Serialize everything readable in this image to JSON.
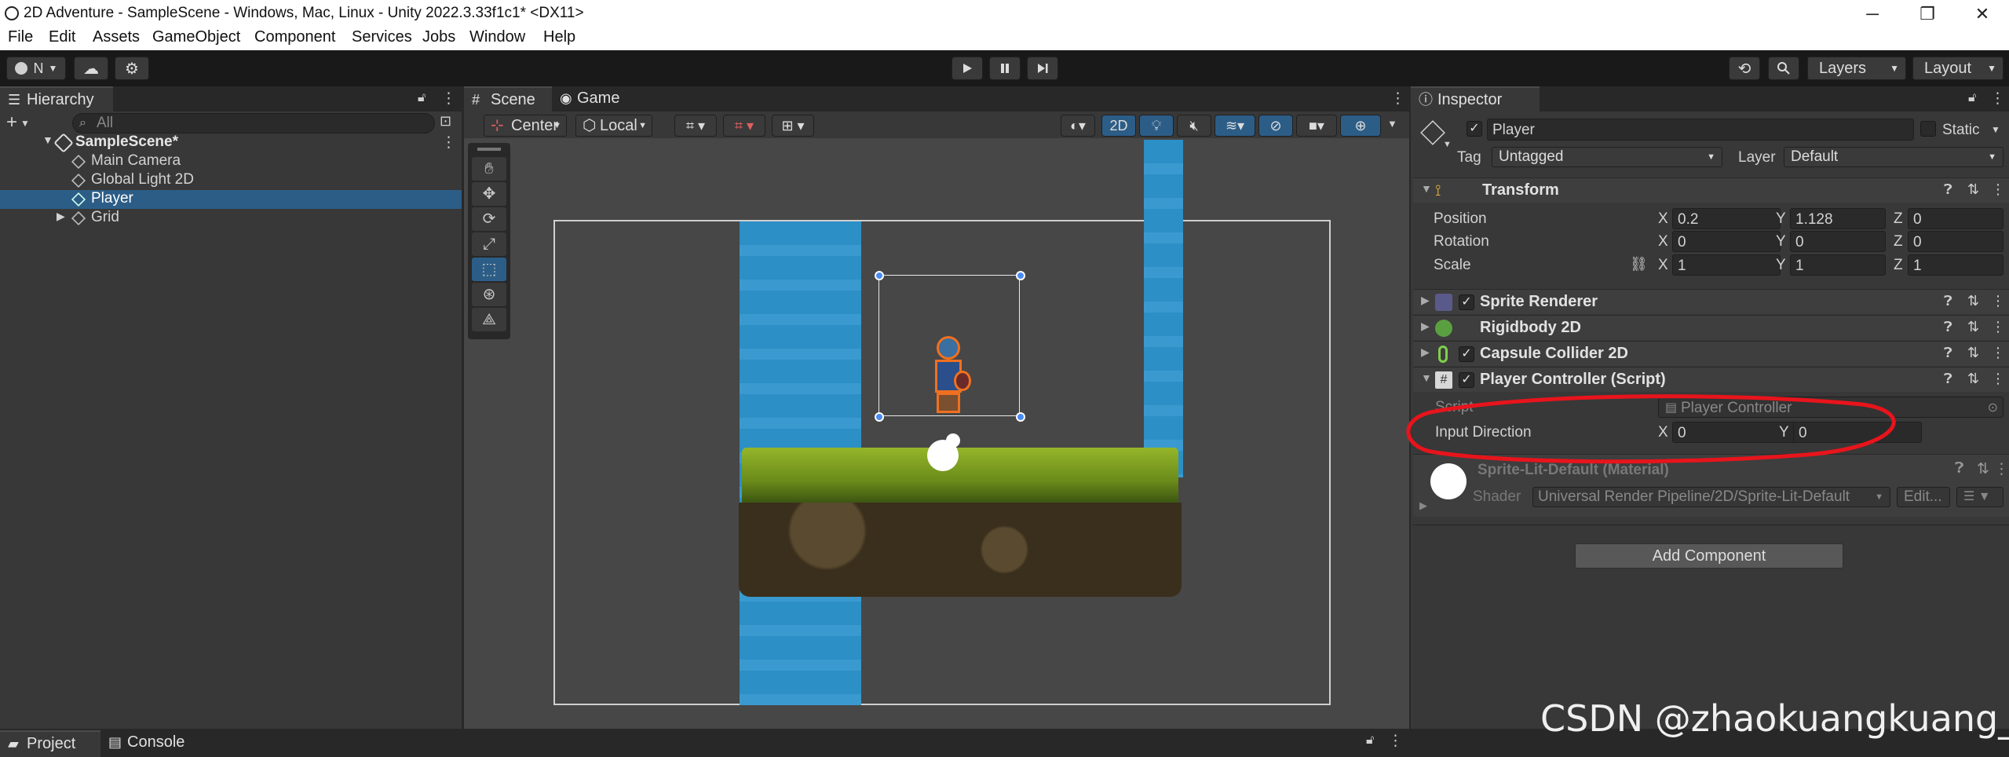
{
  "window": {
    "title": "2D Adventure - SampleScene - Windows, Mac, Linux - Unity 2022.3.33f1c1* <DX11>",
    "minimize": "─",
    "maximize": "❐",
    "close": "✕"
  },
  "menu": [
    "File",
    "Edit",
    "Assets",
    "GameObject",
    "Component",
    "Services",
    "Jobs",
    "Window",
    "Help"
  ],
  "toolbar": {
    "account_label": "N",
    "layers_label": "Layers",
    "layout_label": "Layout"
  },
  "hierarchy": {
    "tab": "Hierarchy",
    "search_placeholder": "All",
    "scene_name": "SampleScene*",
    "items": [
      {
        "label": "Main Camera"
      },
      {
        "label": "Global Light 2D"
      },
      {
        "label": "Player"
      },
      {
        "label": "Grid"
      }
    ]
  },
  "scene": {
    "tab_scene": "Scene",
    "tab_game": "Game",
    "pivot_label": "Center",
    "space_label": "Local",
    "mode_2d": "2D"
  },
  "bottom": {
    "tab_project": "Project",
    "tab_console": "Console"
  },
  "inspector": {
    "tab": "Inspector",
    "object_name": "Player",
    "static_label": "Static",
    "tag_label": "Tag",
    "tag_value": "Untagged",
    "layer_label": "Layer",
    "layer_value": "Default",
    "transform": {
      "title": "Transform",
      "position_label": "Position",
      "rotation_label": "Rotation",
      "scale_label": "Scale",
      "axis_x": "X",
      "axis_y": "Y",
      "axis_z": "Z",
      "position": {
        "x": "0.2",
        "y": "1.128",
        "z": "0"
      },
      "rotation": {
        "x": "0",
        "y": "0",
        "z": "0"
      },
      "scale": {
        "x": "1",
        "y": "1",
        "z": "1"
      }
    },
    "components": [
      {
        "title": "Sprite Renderer"
      },
      {
        "title": "Rigidbody 2D"
      },
      {
        "title": "Capsule Collider 2D"
      },
      {
        "title": "Player Controller (Script)"
      }
    ],
    "script": {
      "script_label": "Script",
      "script_value": "Player Controller",
      "input_label": "Input Direction",
      "input_x": "0",
      "input_y": "0"
    },
    "material": {
      "name": "Sprite-Lit-Default (Material)",
      "shader_label": "Shader",
      "shader_value": "Universal Render Pipeline/2D/Sprite-Lit-Default",
      "edit_label": "Edit..."
    },
    "add_component": "Add Component"
  },
  "watermark": "CSDN @zhaokuangkuang_",
  "colors": {
    "selection": "#2c5d87",
    "annotation": "#e8141c",
    "water": "#2b8fc7"
  },
  "icons": [
    "play-icon",
    "pause-icon",
    "step-icon",
    "hand-icon",
    "move-icon",
    "rotate-icon",
    "scale-icon",
    "rect-icon",
    "transform-icon",
    "custom-icon"
  ]
}
